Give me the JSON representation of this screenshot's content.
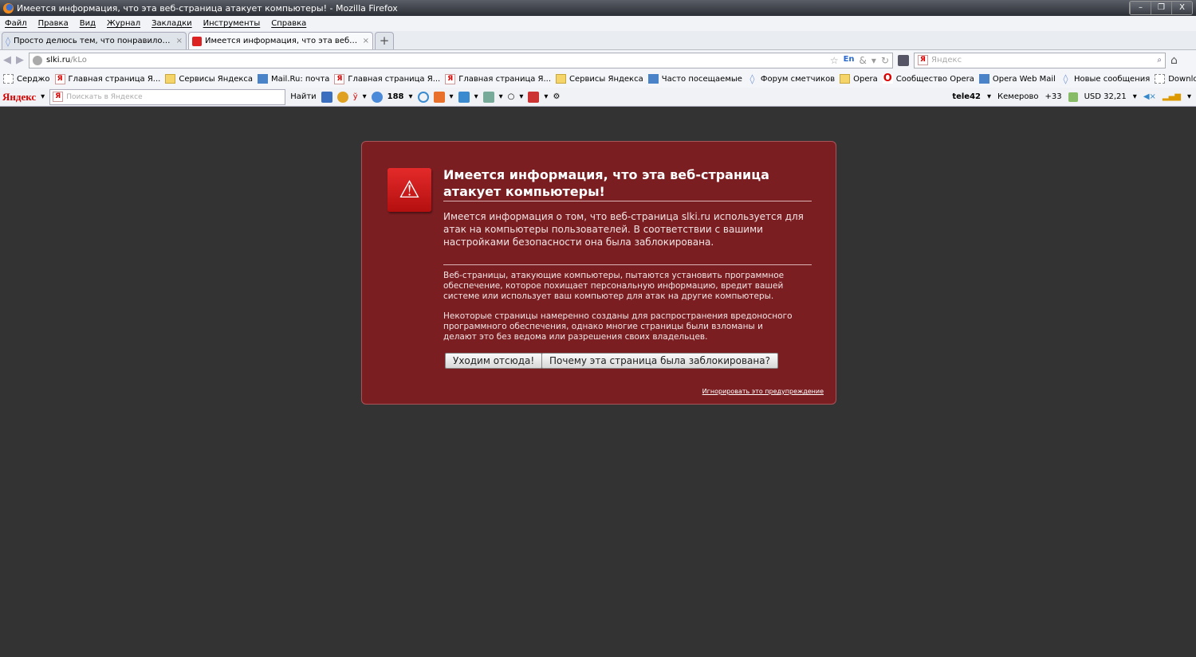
{
  "window": {
    "title": "Имеется информация, что эта веб-страница атакует компьютеры! - Mozilla Firefox",
    "min": "–",
    "max": "❐",
    "close": "X"
  },
  "menu": [
    "Файл",
    "Правка",
    "Вид",
    "Журнал",
    "Закладки",
    "Инструменты",
    "Справка"
  ],
  "tabs": [
    {
      "label": "Просто делюсь тем, что понравилось...."
    },
    {
      "label": "Имеется информация, что эта веб-стр..."
    }
  ],
  "tab_close": "×",
  "new_tab": "+",
  "nav": {
    "back": "◀",
    "forward": "▶",
    "url_host": "slki.ru",
    "url_path": "/kLo",
    "lang": "En",
    "search_placeholder": "Яндекс"
  },
  "bookmarks": [
    {
      "label": "Серджо",
      "icon": "page"
    },
    {
      "label": "Главная страница Я...",
      "icon": "yandex"
    },
    {
      "label": "Сервисы Яндекса",
      "icon": "folder"
    },
    {
      "label": "Mail.Ru: почта",
      "icon": "blue"
    },
    {
      "label": "Главная страница Я...",
      "icon": "yandex"
    },
    {
      "label": "Главная страница Я...",
      "icon": "yandex"
    },
    {
      "label": "Сервисы Яндекса",
      "icon": "folder"
    },
    {
      "label": "Часто посещаемые",
      "icon": "blue"
    },
    {
      "label": "Форум сметчиков",
      "icon": "diamond"
    },
    {
      "label": "Opera",
      "icon": "folder"
    },
    {
      "label": "Сообщество Opera",
      "icon": "opera"
    },
    {
      "label": "Opera Web Mail",
      "icon": "blue"
    },
    {
      "label": "Новые сообщения",
      "icon": "diamond"
    },
    {
      "label": "Download.com",
      "icon": "page"
    }
  ],
  "bookmarks_more": "»",
  "yandex": {
    "logo": "Яндекс",
    "placeholder": "Поискать в Яндексе",
    "find": "Найти",
    "mail_count": "188",
    "user": "tele42",
    "city": "Кемерово",
    "temp": "+33",
    "currency": "USD 32,21"
  },
  "dialog": {
    "title": "Имеется информация, что эта веб-страница атакует компьютеры!",
    "p1": "Имеется информация о том, что веб-страница slki.ru используется для атак на компьютеры пользователей. В соответствии с вашими настройками безопасности она была заблокирована.",
    "p2": "Веб-страницы, атакующие компьютеры, пытаются установить программное обеспечение, которое похищает персональную информацию, вредит вашей системе или использует ваш компьютер для атак на другие компьютеры.",
    "p3": "Некоторые страницы намеренно созданы для распространения вредоносного программного обеспечения, однако многие страницы были взломаны и делают это без ведома или разрешения своих владельцев.",
    "get_me_out": "Уходим отсюда!",
    "why_blocked": "Почему эта страница была заблокирована?",
    "ignore": "Игнорировать это предупреждение"
  }
}
